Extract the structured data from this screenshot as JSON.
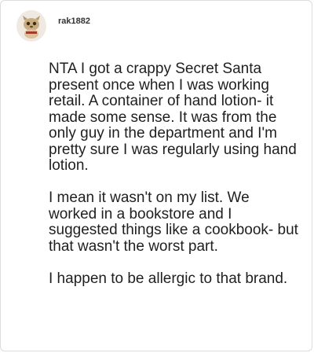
{
  "comment": {
    "username": "rak1882",
    "avatar_icon": "cartoon-animal-avatar-icon",
    "paragraphs": [
      "NTA I got a crappy Secret Santa present once when I was working retail. A container of hand lotion- it made some sense. It was from the only guy in the department and I'm pretty sure I was regularly using hand lotion.",
      "I mean it wasn't on my list. We worked in a bookstore and I suggested things like a cookbook- but that wasn't the worst part.",
      "I happen to be allergic to that brand."
    ]
  },
  "colors": {
    "border": "#dcdcdc",
    "text": "#1f1f1f",
    "username": "#333333"
  }
}
